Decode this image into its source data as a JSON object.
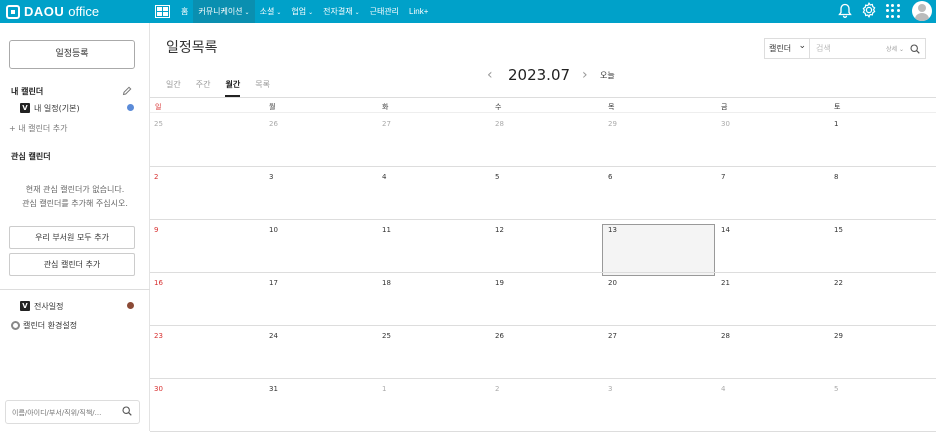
{
  "app": {
    "brand": "DAOU",
    "suffix": "office"
  },
  "nav": [
    {
      "label": "홈",
      "caret": false
    },
    {
      "label": "커뮤니케이션",
      "caret": true
    },
    {
      "label": "소셜",
      "caret": true
    },
    {
      "label": "협업",
      "caret": true
    },
    {
      "label": "전자결재",
      "caret": true
    },
    {
      "label": "근태관리",
      "caret": false
    },
    {
      "label": "Link+",
      "caret": false
    }
  ],
  "sidebar": {
    "register_button": "일정등록",
    "my_calendar_title": "내 캘린더",
    "my_calendar_item": "내 일정(기본)",
    "my_calendar_color": "#5b8bd8",
    "add_my_calendar": "내 캘린더 추가",
    "interest_title": "관심 캘린더",
    "empty_line1": "현재 관심 캘린더가 없습니다.",
    "empty_line2": "관심 캘린더를 추가해 주십시오.",
    "add_department_button": "우리 부서원 모두 추가",
    "add_interest_button": "관심 캘린더 추가",
    "company_calendar": "전사일정",
    "company_calendar_color": "#8b4a36",
    "settings_label": "캘린더 환경설정",
    "search_placeholder": "이름/아이디/부서/직위/직책/..."
  },
  "main": {
    "title": "일정목록",
    "view_select": "캘린더",
    "search_placeholder": "검색",
    "detail_label": "상세",
    "tabs": [
      {
        "label": "일간",
        "active": false
      },
      {
        "label": "주간",
        "active": false
      },
      {
        "label": "월간",
        "active": true
      },
      {
        "label": "목록",
        "active": false
      }
    ],
    "month": "2023.07",
    "today_button": "오늘"
  },
  "calendar": {
    "weekdays": [
      "일",
      "월",
      "화",
      "수",
      "목",
      "금",
      "토"
    ],
    "weeks": [
      [
        "25",
        "26",
        "27",
        "28",
        "29",
        "30",
        "1"
      ],
      [
        "2",
        "3",
        "4",
        "5",
        "6",
        "7",
        "8"
      ],
      [
        "9",
        "10",
        "11",
        "12",
        "13",
        "14",
        "15"
      ],
      [
        "16",
        "17",
        "18",
        "19",
        "20",
        "21",
        "22"
      ],
      [
        "23",
        "24",
        "25",
        "26",
        "27",
        "28",
        "29"
      ],
      [
        "30",
        "31",
        "1",
        "2",
        "3",
        "4",
        "5"
      ]
    ],
    "today": "13",
    "accent_color": "#00a1c9",
    "sunday_color": "#d83030"
  }
}
